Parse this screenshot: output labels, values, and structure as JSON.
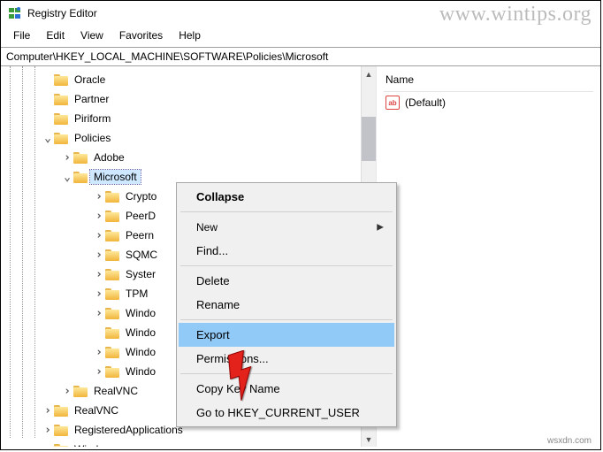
{
  "window": {
    "title": "Registry Editor"
  },
  "watermark": "www.wintips.org",
  "watermark_small": "wsxdn.com",
  "menu": {
    "file": "File",
    "edit": "Edit",
    "view": "View",
    "favorites": "Favorites",
    "help": "Help"
  },
  "path": "Computer\\HKEY_LOCAL_MACHINE\\SOFTWARE\\Policies\\Microsoft",
  "tree": {
    "items": [
      {
        "level": "lv1",
        "exp": "",
        "label": "Oracle"
      },
      {
        "level": "lv1",
        "exp": "",
        "label": "Partner"
      },
      {
        "level": "lv1",
        "exp": "",
        "label": "Piriform"
      },
      {
        "level": "lv1",
        "exp": "v",
        "label": "Policies"
      },
      {
        "level": "lv2",
        "exp": ">",
        "label": "Adobe"
      },
      {
        "level": "lv2",
        "exp": "v",
        "label": "Microsoft",
        "selected": true
      },
      {
        "level": "lv3b",
        "exp": ">",
        "label": "Crypto"
      },
      {
        "level": "lv3b",
        "exp": ">",
        "label": "PeerD"
      },
      {
        "level": "lv3b",
        "exp": ">",
        "label": "Peern"
      },
      {
        "level": "lv3b",
        "exp": ">",
        "label": "SQMC"
      },
      {
        "level": "lv3b",
        "exp": ">",
        "label": "Syster"
      },
      {
        "level": "lv3b",
        "exp": ">",
        "label": "TPM"
      },
      {
        "level": "lv3b",
        "exp": ">",
        "label": "Windo"
      },
      {
        "level": "lv3b",
        "exp": "",
        "label": "Windo"
      },
      {
        "level": "lv3b",
        "exp": ">",
        "label": "Windo"
      },
      {
        "level": "lv3b",
        "exp": ">",
        "label": "Windo"
      },
      {
        "level": "lv2",
        "exp": ">",
        "label": "RealVNC"
      },
      {
        "level": "lv1",
        "exp": ">",
        "label": "RealVNC"
      },
      {
        "level": "lv1",
        "exp": ">",
        "label": "RegisteredApplications"
      },
      {
        "level": "lv1",
        "exp": ">",
        "label": "Windows"
      }
    ]
  },
  "details": {
    "header_name": "Name",
    "default_value": "(Default)"
  },
  "context": {
    "collapse": "Collapse",
    "new": "New",
    "find": "Find...",
    "delete": "Delete",
    "rename": "Rename",
    "export": "Export",
    "permissions": "Permissions...",
    "copykey": "Copy Key Name",
    "goto": "Go to HKEY_CURRENT_USER"
  }
}
